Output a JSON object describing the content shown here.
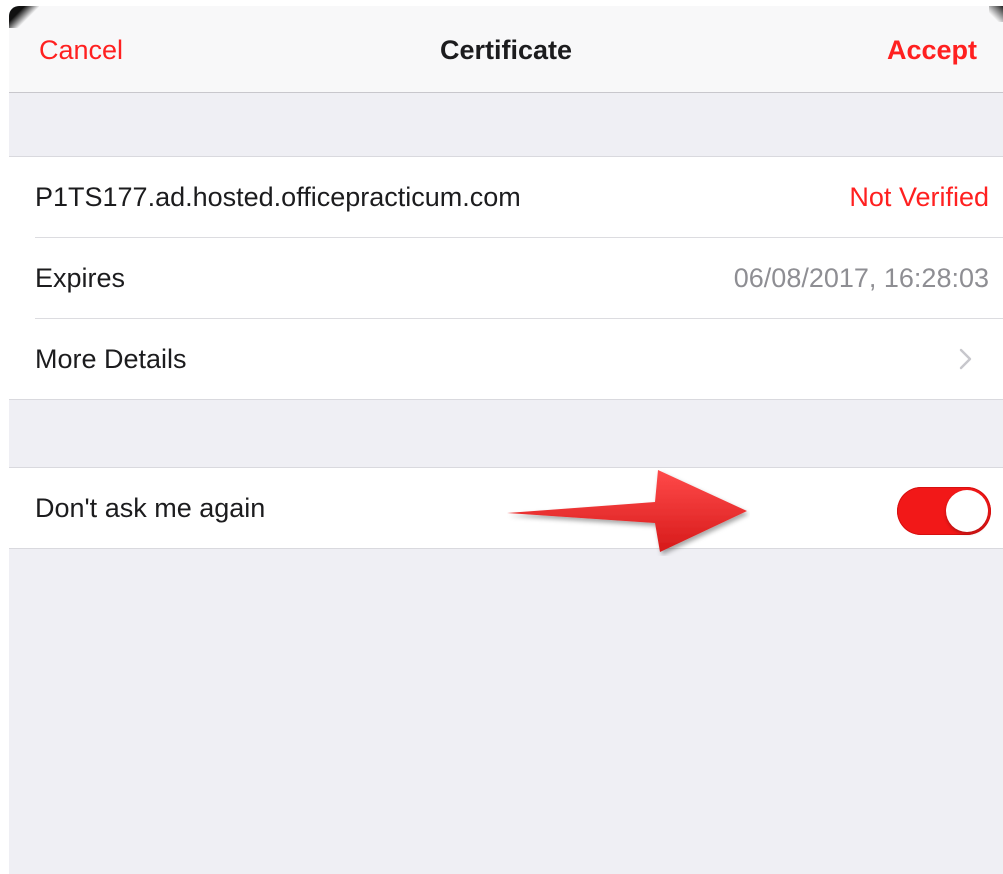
{
  "navbar": {
    "cancel_label": "Cancel",
    "title": "Certificate",
    "accept_label": "Accept"
  },
  "certificate": {
    "host": "P1TS177.ad.hosted.officepracticum.com",
    "status": "Not Verified",
    "expires_label": "Expires",
    "expires_value": "06/08/2017, 16:28:03",
    "more_details_label": "More Details"
  },
  "settings": {
    "dont_ask_label": "Don't ask me again",
    "dont_ask_enabled": true
  },
  "colors": {
    "accent": "#ff2020",
    "toggle_on": "#f21818",
    "background": "#efeff4",
    "secondary_text": "#8e8e93",
    "annotation_arrow": "#ee2a2a"
  },
  "icons": {
    "more_details": "chevron-right-icon",
    "annotation": "red-arrow-annotation"
  }
}
